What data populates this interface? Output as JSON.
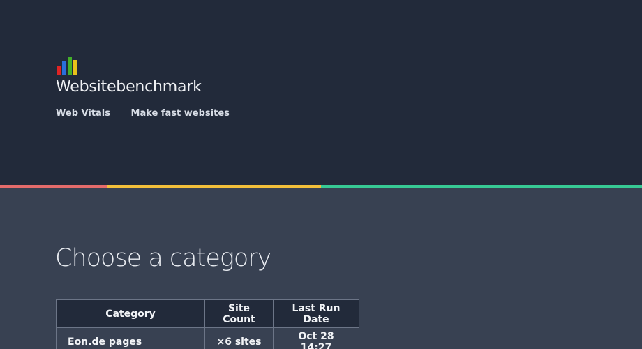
{
  "header": {
    "brand": "Websitebenchmark",
    "nav": [
      "Web Vitals",
      "Make fast websites"
    ],
    "logo": "bar-chart-logo"
  },
  "colors": {
    "header_bg": "#222a3a",
    "page_bg": "#384152",
    "stripe": [
      "#e46b6b",
      "#f2bf3a",
      "#37c994"
    ],
    "logo_bars": [
      "#e02424",
      "#2a6fdb",
      "#43b02a",
      "#e8c21a"
    ]
  },
  "main": {
    "title": "Choose a category",
    "table": {
      "columns": [
        "Category",
        "Site Count",
        "Last Run Date"
      ],
      "rows": [
        {
          "category": "Eon.de pages",
          "count": "×6 sites",
          "date": "Oct 28 14:27"
        }
      ]
    }
  }
}
